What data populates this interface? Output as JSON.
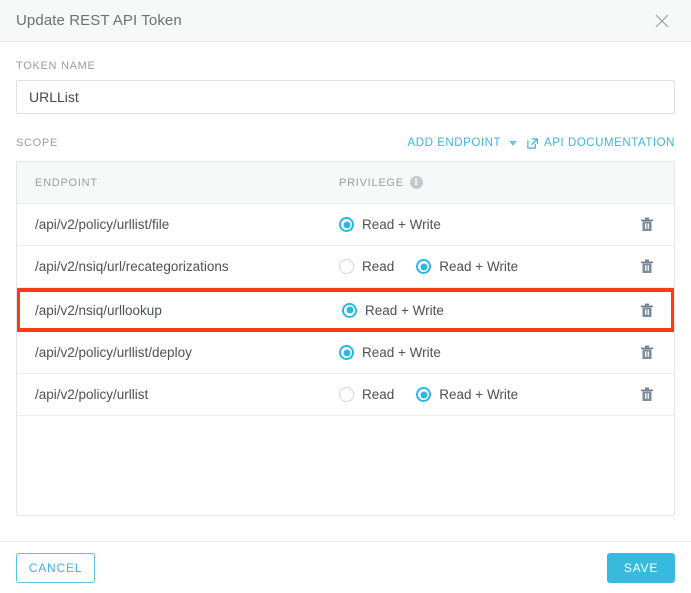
{
  "header": {
    "title": "Update REST API Token",
    "close_icon": "close-icon"
  },
  "token_name": {
    "label": "TOKEN NAME",
    "value": "URLList",
    "placeholder": "Token name"
  },
  "scope": {
    "label": "SCOPE",
    "add_endpoint_label": "ADD ENDPOINT",
    "caret_icon": "chevron-down-icon",
    "api_doc_label": "API DOCUMENTATION",
    "ext_link_icon": "external-link-icon"
  },
  "table": {
    "columns": [
      "ENDPOINT",
      "PRIVILEGE"
    ],
    "info_icon": "info-icon",
    "info_glyph": "i",
    "delete_icon": "trash-icon",
    "rows": [
      {
        "endpoint": "/api/v2/policy/urllist/file",
        "options": [
          {
            "label": "Read + Write",
            "checked": true
          }
        ],
        "highlighted": false
      },
      {
        "endpoint": "/api/v2/nsiq/url/recategorizations",
        "options": [
          {
            "label": "Read",
            "checked": false
          },
          {
            "label": "Read + Write",
            "checked": true
          }
        ],
        "highlighted": false
      },
      {
        "endpoint": "/api/v2/nsiq/urllookup",
        "options": [
          {
            "label": "Read + Write",
            "checked": true
          }
        ],
        "highlighted": true
      },
      {
        "endpoint": "/api/v2/policy/urllist/deploy",
        "options": [
          {
            "label": "Read + Write",
            "checked": true
          }
        ],
        "highlighted": false
      },
      {
        "endpoint": "/api/v2/policy/urllist",
        "options": [
          {
            "label": "Read",
            "checked": false
          },
          {
            "label": "Read + Write",
            "checked": true
          }
        ],
        "highlighted": false
      }
    ]
  },
  "footer": {
    "cancel_label": "CANCEL",
    "save_label": "SAVE"
  },
  "colors": {
    "accent": "#38bade",
    "link": "#3cb6dd",
    "highlight": "#fb3b10",
    "header_bg": "#f7f8f8",
    "text": "#4d5154",
    "muted": "#9a9da1"
  }
}
